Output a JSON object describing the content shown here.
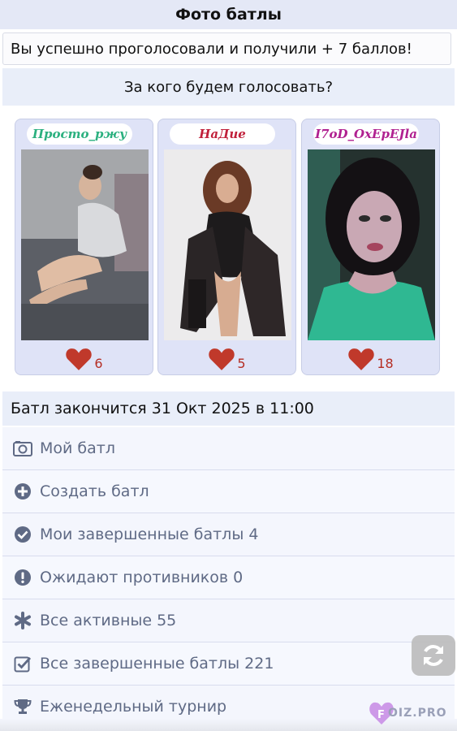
{
  "header": {
    "title": "Фото батлы"
  },
  "notice": {
    "text": "Вы успешно проголосовали и получили + 7 баллов!"
  },
  "question": {
    "text": "За кого будем голосовать?"
  },
  "candidates": [
    {
      "name": "Просто_ржу",
      "votes": "6"
    },
    {
      "name": "НаДие",
      "votes": "5"
    },
    {
      "name": "I7oD_OxEpEJla",
      "votes": "18"
    }
  ],
  "battle": {
    "ends_text": "Батл закончится 31 Окт 2025 в 11:00"
  },
  "menu": {
    "items": [
      {
        "label": "Мой батл",
        "icon": "camera-icon"
      },
      {
        "label": "Создать батл",
        "icon": "plus-circle-icon"
      },
      {
        "label": "Мои завершенные батлы 4",
        "icon": "check-circle-icon"
      },
      {
        "label": "Ожидают противников 0",
        "icon": "exclamation-circle-icon"
      },
      {
        "label": "Все активные 55",
        "icon": "asterisk-icon"
      },
      {
        "label": "Все завершенные батлы 221",
        "icon": "check-square-icon"
      },
      {
        "label": "Еженедельный турнир",
        "icon": "trophy-icon"
      }
    ]
  },
  "watermark": {
    "text": "OIZ.PRO"
  },
  "colors": {
    "accent": "#e4e8f6",
    "heart": "#c0392b",
    "menu_text": "#5f6a85"
  }
}
